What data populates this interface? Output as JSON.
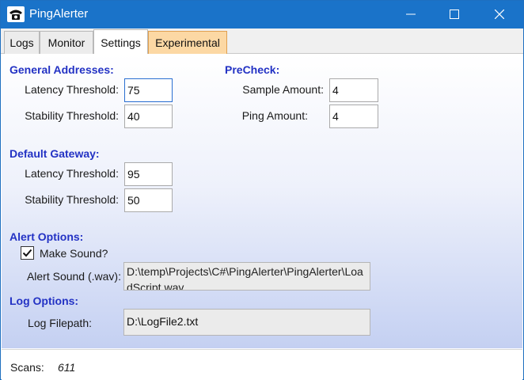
{
  "window": {
    "title": "PingAlerter",
    "icon": "phone-icon",
    "controls": [
      "minimize-icon",
      "maximize-icon",
      "close-icon"
    ]
  },
  "tabs": [
    {
      "label": "Logs"
    },
    {
      "label": "Monitor"
    },
    {
      "label": "Settings",
      "active": true
    },
    {
      "label": "Experimental"
    }
  ],
  "general": {
    "heading": "General Addresses:",
    "latency_label": "Latency Threshold:",
    "latency_value": "75",
    "stability_label": "Stability Threshold:",
    "stability_value": "40"
  },
  "precheck": {
    "heading": "PreCheck:",
    "sample_label": "Sample Amount:",
    "sample_value": "4",
    "ping_label": "Ping Amount:",
    "ping_value": "4"
  },
  "gateway": {
    "heading": "Default Gateway:",
    "latency_label": "Latency Threshold:",
    "latency_value": "95",
    "stability_label": "Stability Threshold:",
    "stability_value": "50"
  },
  "alert": {
    "heading": "Alert Options:",
    "make_sound_label": "Make Sound?",
    "make_sound_checked": true,
    "sound_label": "Alert Sound (.wav):",
    "sound_path": "D:\\temp\\Projects\\C#\\PingAlerter\\PingAlerter\\LoadScript.wav"
  },
  "log": {
    "heading": "Log Options:",
    "filepath_label": "Log Filepath:",
    "filepath_value": "D:\\LogFile2.txt"
  },
  "status": {
    "scans_label": "Scans:",
    "scans_value": "611"
  },
  "colors": {
    "titlebar": "#1a73c9",
    "heading": "#2332c4",
    "experimental_tab": "#fcd8a4"
  }
}
